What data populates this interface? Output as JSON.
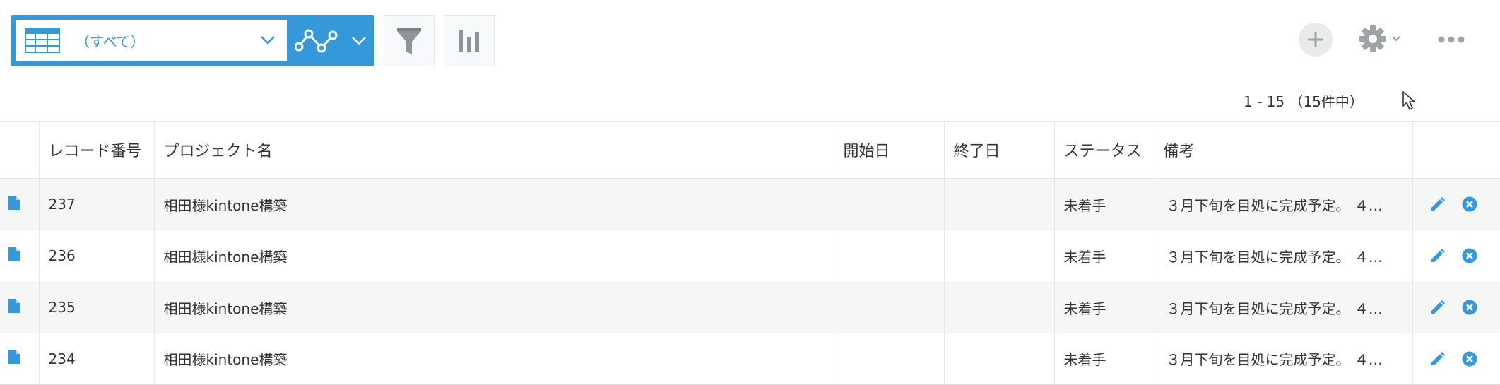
{
  "toolbar": {
    "view_name": "（すべて）",
    "accent_color": "#3498db",
    "icons": {
      "view_list": "table-icon",
      "graph": "line-graph-icon",
      "filter": "funnel-icon",
      "chart": "bar-chart-icon",
      "add": "plus-icon",
      "settings": "gear-icon",
      "more": "ellipsis-icon"
    }
  },
  "pagination": {
    "label": "1 - 15 （15件中）"
  },
  "table": {
    "headers": {
      "record_no": "レコード番号",
      "project": "プロジェクト名",
      "start": "開始日",
      "end": "終了日",
      "status": "ステータス",
      "note": "備考"
    },
    "rows": [
      {
        "record_no": "237",
        "project": "相田様kintone構築",
        "start": "",
        "end": "",
        "status": "未着手",
        "note": "３月下旬を目処に完成予定。 ４…"
      },
      {
        "record_no": "236",
        "project": "相田様kintone構築",
        "start": "",
        "end": "",
        "status": "未着手",
        "note": "３月下旬を目処に完成予定。 ４…"
      },
      {
        "record_no": "235",
        "project": "相田様kintone構築",
        "start": "",
        "end": "",
        "status": "未着手",
        "note": "３月下旬を目処に完成予定。 ４…"
      },
      {
        "record_no": "234",
        "project": "相田様kintone構築",
        "start": "",
        "end": "",
        "status": "未着手",
        "note": "３月下旬を目処に完成予定。 ４…"
      }
    ]
  }
}
